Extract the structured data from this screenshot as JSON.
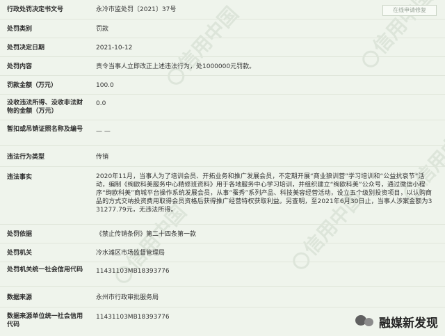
{
  "button": {
    "label": "在线申请修复"
  },
  "rows": [
    {
      "label": "行政处罚决定书文号",
      "value": "永冷市监处罚〔2021〕37号"
    },
    {
      "label": "处罚类别",
      "value": "罚款"
    },
    {
      "label": "处罚决定日期",
      "value": "2021-10-12"
    },
    {
      "label": "处罚内容",
      "value": "责令当事人立即改正上述违法行为，处1000000元罚款。"
    },
    {
      "label": "罚款金额（万元）",
      "value": "100.0"
    },
    {
      "label": "没收违法所得、没收非法财物的金额（万元）",
      "value": "0.0"
    },
    {
      "label": "暂扣或吊销证照名称及编号",
      "value": "— —"
    },
    {
      "label": "违法行为类型",
      "value": "传销"
    },
    {
      "label": "违法事实",
      "value": "2020年11月，当事人为了培训会员、开拓业务和推广发展会员，不定期开展“商业狼训营”学习培训和“公益抗衰节”活动，编制《绚欧科美服务中心精修班资料》用于各地服务中心学习培训，并组织建立“绚欧科美”公众号，通过微信小程序“绚欧科美”商城平台操作系统发展会员，从事“蚕秀”系列产品、科技美容经营活动，设立五个级别投资项目，以认购商品的方式交纳投资费用取得会员资格后获得推广经营特权获取利益。另查明，至2021年6月30日止，当事人涉案金额为331277.79元，无违法所得。"
    },
    {
      "label": "处罚依据",
      "value": "《禁止传销条例》第二十四条第一款"
    },
    {
      "label": "处罚机关",
      "value": "冷水滩区市场监督管理局"
    },
    {
      "label": "处罚机关统一社会信用代码",
      "value": "11431103MB18393776"
    },
    {
      "label": "数据来源",
      "value": "永州市行政审批服务局"
    },
    {
      "label": "数据来源单位统一社会信用代码",
      "value": "11431103MB18393776"
    }
  ],
  "watermark": {
    "text": "信用中国"
  },
  "brand": {
    "text": "融媒新发现"
  }
}
